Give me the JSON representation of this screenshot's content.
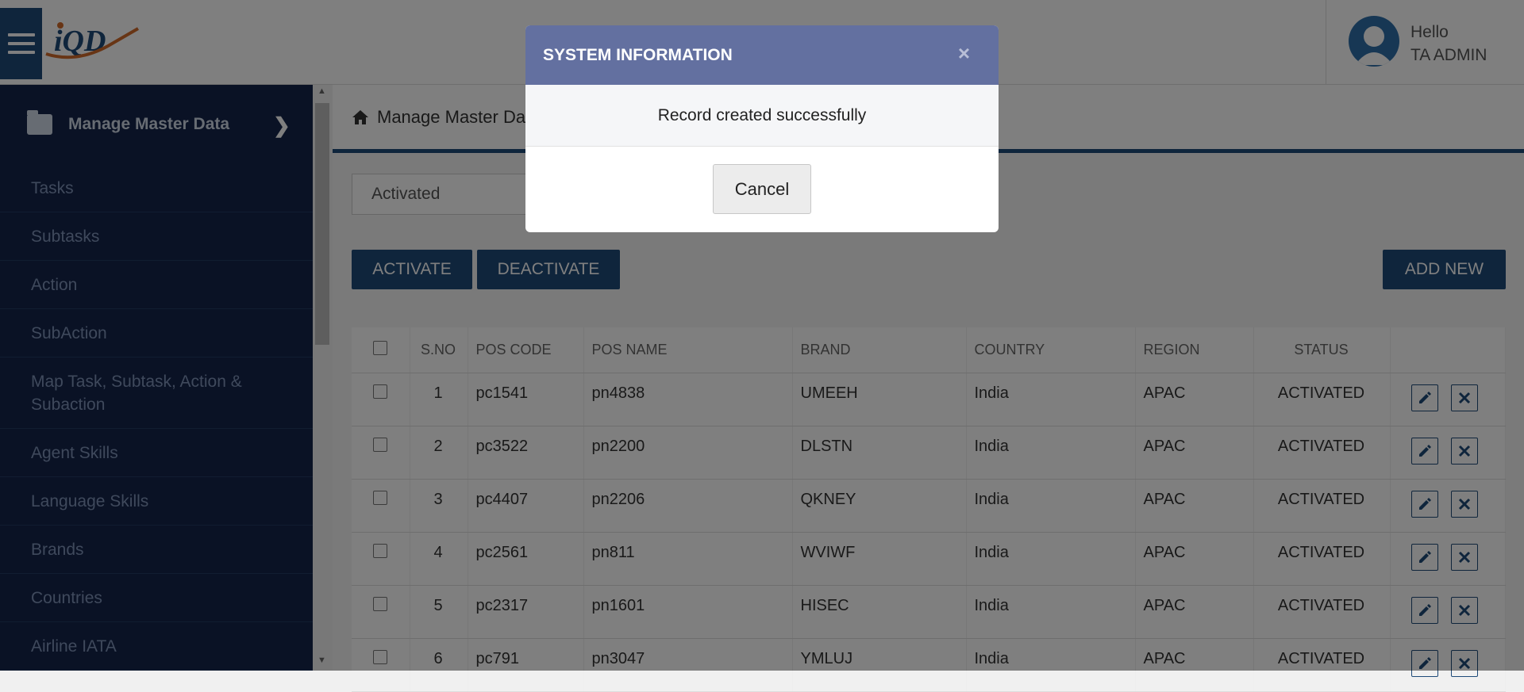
{
  "header": {
    "greeting": "Hello",
    "user_name": "TA ADMIN"
  },
  "sidebar": {
    "section_title": "Manage Master Data",
    "items": [
      {
        "label": "Tasks"
      },
      {
        "label": "Subtasks"
      },
      {
        "label": "Action"
      },
      {
        "label": "SubAction"
      },
      {
        "label": "Map Task, Subtask, Action & Subaction"
      },
      {
        "label": "Agent Skills"
      },
      {
        "label": "Language Skills"
      },
      {
        "label": "Brands"
      },
      {
        "label": "Countries"
      },
      {
        "label": "Airline IATA"
      }
    ]
  },
  "main": {
    "breadcrumb": "Manage Master Data",
    "filter_value": "Activated",
    "activate_label": "ACTIVATE",
    "deactivate_label": "DEACTIVATE",
    "add_new_label": "ADD NEW"
  },
  "table": {
    "columns": [
      "S.NO",
      "POS CODE",
      "POS NAME",
      "BRAND",
      "COUNTRY",
      "REGION",
      "STATUS"
    ],
    "rows": [
      {
        "sno": "1",
        "code": "pc1541",
        "name": "pn4838",
        "brand": "UMEEH",
        "country": "India",
        "region": "APAC",
        "status": "ACTIVATED"
      },
      {
        "sno": "2",
        "code": "pc3522",
        "name": "pn2200",
        "brand": "DLSTN",
        "country": "India",
        "region": "APAC",
        "status": "ACTIVATED"
      },
      {
        "sno": "3",
        "code": "pc4407",
        "name": "pn2206",
        "brand": "QKNEY",
        "country": "India",
        "region": "APAC",
        "status": "ACTIVATED"
      },
      {
        "sno": "4",
        "code": "pc2561",
        "name": "pn811",
        "brand": "WVIWF",
        "country": "India",
        "region": "APAC",
        "status": "ACTIVATED"
      },
      {
        "sno": "5",
        "code": "pc2317",
        "name": "pn1601",
        "brand": "HISEC",
        "country": "India",
        "region": "APAC",
        "status": "ACTIVATED"
      },
      {
        "sno": "6",
        "code": "pc791",
        "name": "pn3047",
        "brand": "YMLUJ",
        "country": "India",
        "region": "APAC",
        "status": "ACTIVATED"
      }
    ]
  },
  "modal": {
    "title": "SYSTEM INFORMATION",
    "close_glyph": "×",
    "message": "Record created successfully",
    "cancel_label": "Cancel"
  },
  "colors": {
    "primary": "#1e4a78",
    "sidebar_bg": "#14254a",
    "modal_header": "#6370a0"
  }
}
